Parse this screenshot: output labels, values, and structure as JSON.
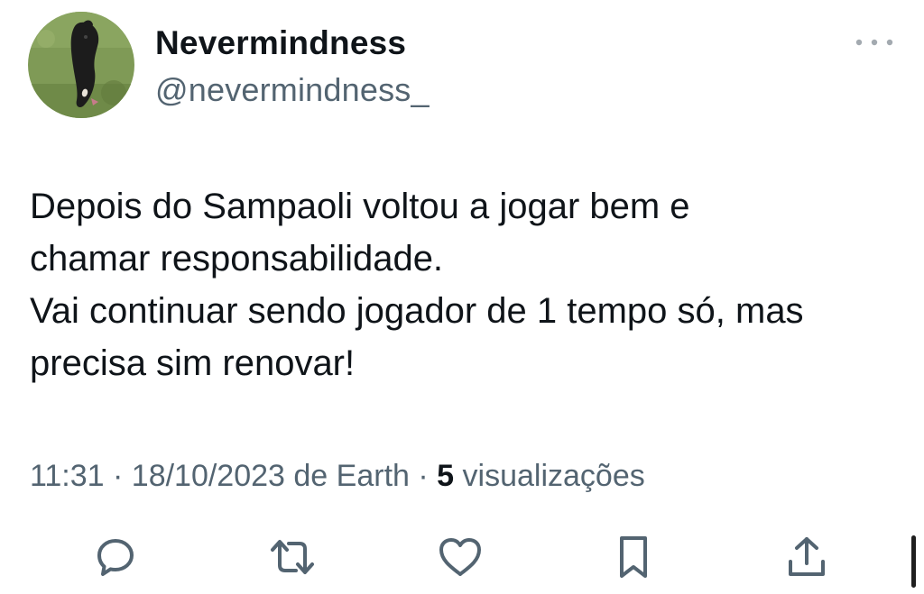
{
  "author": {
    "display_name": "Nevermindness",
    "handle": "@nevermindness_"
  },
  "tweet": {
    "lines": [
      "Depois do Sampaoli voltou a jogar bem e",
      "chamar responsabilidade.",
      "Vai continuar sendo jogador de 1 tempo só, mas",
      "precisa sim renovar!"
    ]
  },
  "meta": {
    "time": "11:31",
    "separator1": " · ",
    "date": "18/10/2023",
    "source": " de Earth",
    "separator2": " · ",
    "views_count": "5",
    "views_label": " visualizações"
  },
  "icons": {
    "more": "more-horizontal-icon",
    "reply": "reply-icon",
    "retweet": "retweet-icon",
    "like": "heart-icon",
    "bookmark": "bookmark-icon",
    "share": "share-icon"
  },
  "colors": {
    "text_primary": "#0f1419",
    "text_secondary": "#536471",
    "icon": "#536471"
  }
}
